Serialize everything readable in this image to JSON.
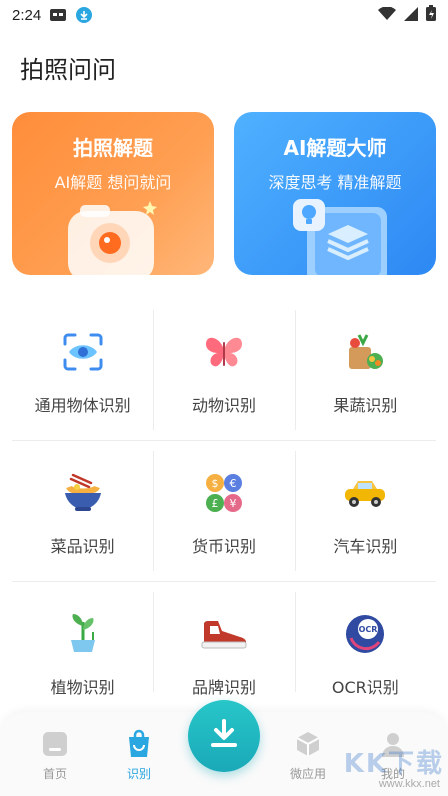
{
  "status": {
    "time": "2:24"
  },
  "page_title": "拍照问问",
  "cards": [
    {
      "title": "拍照解题",
      "subtitle": "AI解题  想问就问"
    },
    {
      "title": "AI解题大师",
      "subtitle": "深度思考  精准解题"
    }
  ],
  "grid": [
    {
      "label": "通用物体识别",
      "icon": "scan-eye-icon"
    },
    {
      "label": "动物识别",
      "icon": "butterfly-icon"
    },
    {
      "label": "果蔬识别",
      "icon": "vegetable-basket-icon"
    },
    {
      "label": "菜品识别",
      "icon": "noodle-bowl-icon"
    },
    {
      "label": "货币识别",
      "icon": "coins-icon"
    },
    {
      "label": "汽车识别",
      "icon": "car-icon"
    },
    {
      "label": "植物识别",
      "icon": "plant-icon"
    },
    {
      "label": "品牌识别",
      "icon": "sneaker-icon"
    },
    {
      "label": "OCR识别",
      "icon": "ocr-icon"
    }
  ],
  "nav": [
    {
      "label": "首页"
    },
    {
      "label": "识别"
    },
    {
      "label": "微应用"
    },
    {
      "label": "我的"
    }
  ],
  "watermark": {
    "logo": "KK下载",
    "url": "www.kkx.net"
  },
  "colors": {
    "accent": "#2aa6e0",
    "orange": "#ff8d3a",
    "blue": "#2d88f3",
    "fab": "#1aa9b8"
  }
}
